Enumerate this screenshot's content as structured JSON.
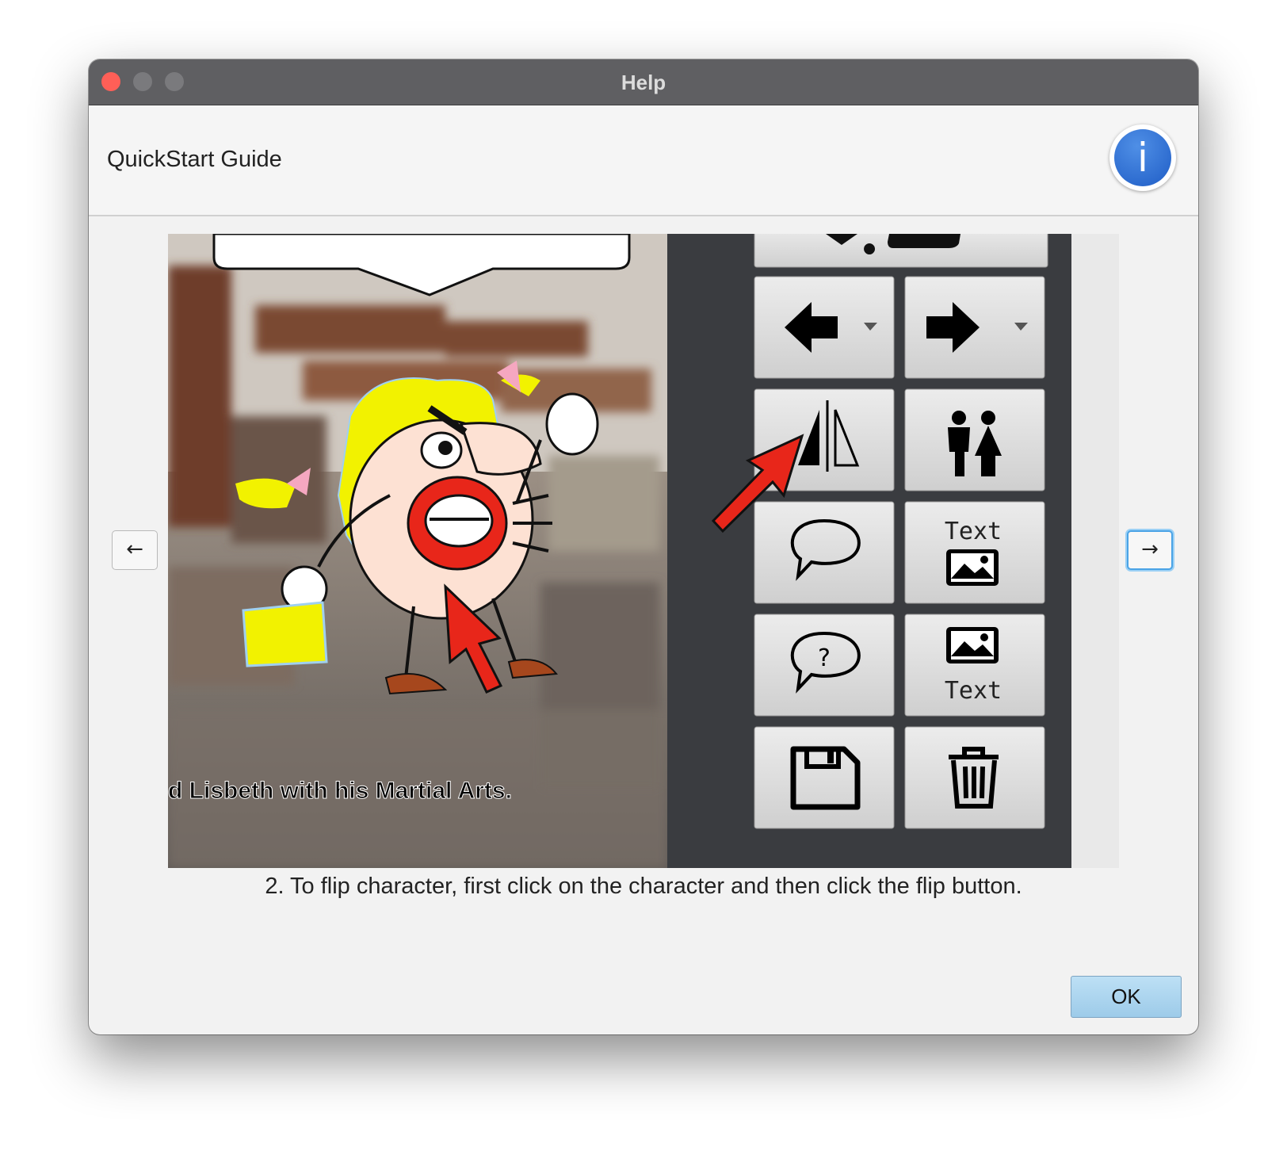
{
  "window": {
    "title": "Help"
  },
  "header": {
    "title": "QuickStart Guide",
    "info_icon_glyph": "i"
  },
  "navigation": {
    "prev_glyph": "←",
    "next_glyph": "→"
  },
  "slide": {
    "subtitle": "d Lisbeth with his Martial Arts.",
    "toolbar_text_label_1": "Text",
    "toolbar_text_label_2": "Text",
    "question_glyph": "?",
    "toolbar_buttons": [
      "move-left-icon",
      "move-right-icon",
      "flip-icon",
      "characters-icon",
      "speech-bubble-icon",
      "text-image-icon",
      "thought-bubble-icon",
      "image-text-icon",
      "save-icon",
      "trash-icon"
    ]
  },
  "caption": "2. To flip character, first click on the character and then click the flip button.",
  "footer": {
    "ok_label": "OK"
  },
  "colors": {
    "titlebar": "#5f5f62",
    "close": "#ff5f57",
    "info_blue": "#2f6fd6",
    "ok_button": "#abd5ef",
    "arrow_red": "#e8261a",
    "hair_yellow": "#f2f200"
  }
}
